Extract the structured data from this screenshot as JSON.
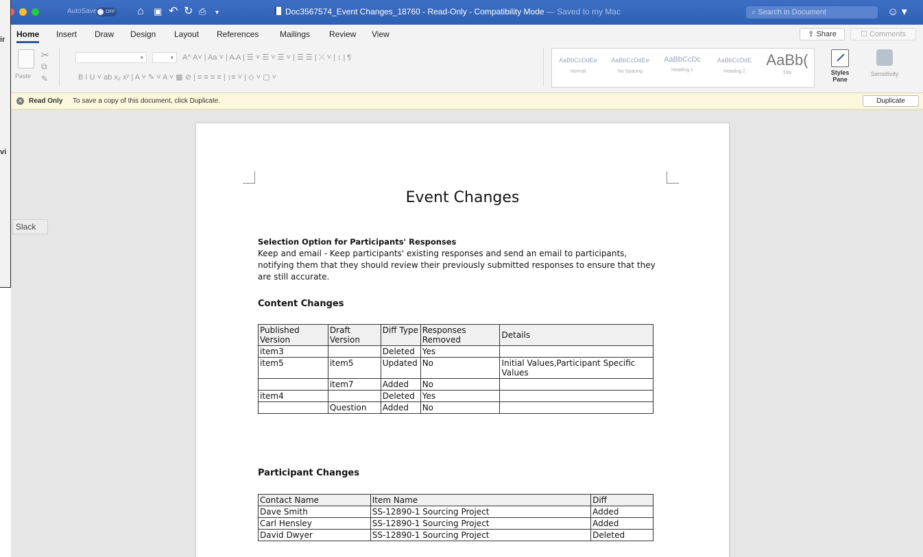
{
  "background_window": {
    "fragments": [
      "ir",
      "vi"
    ]
  },
  "titlebar": {
    "autosave_label": "AutoSave",
    "autosave_state": "OFF",
    "title": "Doc3567574_Event Changes_18760 - Read-Only - Compatibility Mode",
    "saved_status": "— Saved to my Mac",
    "search_placeholder": "Search in Document"
  },
  "ribbon_tabs": [
    "Home",
    "Insert",
    "Draw",
    "Design",
    "Layout",
    "References",
    "Mailings",
    "Review",
    "View"
  ],
  "ribbon_actions": {
    "share": "Share",
    "comments": "Comments"
  },
  "ribbon": {
    "paste_label": "Paste",
    "font_row": "A^  A˅  |  Aa ˅  |  A̶  A  |  ☰ ˅  ☰ ˅  ☰ ˅  |  ☰  ☰  |  ⤫ ˅  |  ↕  |  ¶",
    "format_row": "B   I   U ˅  ab  x₂  x²  |  A ˅  ✎ ˅  A ˅  ▦  ⊘  |  ≡  ≡  ≡  ≡  |  ↕≡ ˅  |  ◇ ˅  ▢ ˅",
    "styles": [
      {
        "sample": "AaBbCcDdEe",
        "name": "Normal"
      },
      {
        "sample": "AaBbCcDdEe",
        "name": "No Spacing"
      },
      {
        "sample": "AaBbCcDc",
        "name": "Heading 1"
      },
      {
        "sample": "AaBbCcDdE",
        "name": "Heading 2"
      },
      {
        "sample": "AaBb(",
        "name": "Title"
      }
    ],
    "styles_pane": "Styles Pane",
    "sensitivity": "Sensitivity"
  },
  "readonly_bar": {
    "label": "Read Only",
    "message": "To save a copy of this document, click Duplicate.",
    "button": "Duplicate"
  },
  "sidebar_chip": "Slack",
  "document": {
    "title": "Event Changes",
    "selection_heading": "Selection Option for Participants' Responses",
    "selection_body": "Keep and email - Keep participants' existing responses and send an email to participants, notifying them that they should review their previously submitted responses to ensure that they are still accurate.",
    "content_heading": "Content Changes",
    "content_table": {
      "headers": [
        "Published Version",
        "Draft Version",
        "Diff Type",
        "Responses Removed",
        "Details"
      ],
      "rows": [
        [
          "item3",
          "",
          "Deleted",
          "Yes",
          ""
        ],
        [
          "item5",
          "item5",
          "Updated",
          "No",
          "Initial Values,Participant Specific Values"
        ],
        [
          "",
          "item7",
          "Added",
          "No",
          ""
        ],
        [
          "item4",
          "",
          "Deleted",
          "Yes",
          ""
        ],
        [
          "",
          "Question",
          "Added",
          "No",
          ""
        ]
      ]
    },
    "participant_heading": "Participant Changes",
    "participant_table": {
      "headers": [
        "Contact Name",
        "Item Name",
        "Diff"
      ],
      "rows": [
        [
          "Dave Smith",
          "SS-12890-1 Sourcing Project",
          "Added"
        ],
        [
          "Carl Hensley",
          "SS-12890-1 Sourcing Project",
          "Added"
        ],
        [
          "David Dwyer",
          "SS-12890-1 Sourcing Project",
          "Deleted"
        ]
      ]
    }
  },
  "colors": {
    "titlebar": "#2f5fb3",
    "accent": "#2b579a",
    "readonly_bar": "#fcf7dc"
  }
}
